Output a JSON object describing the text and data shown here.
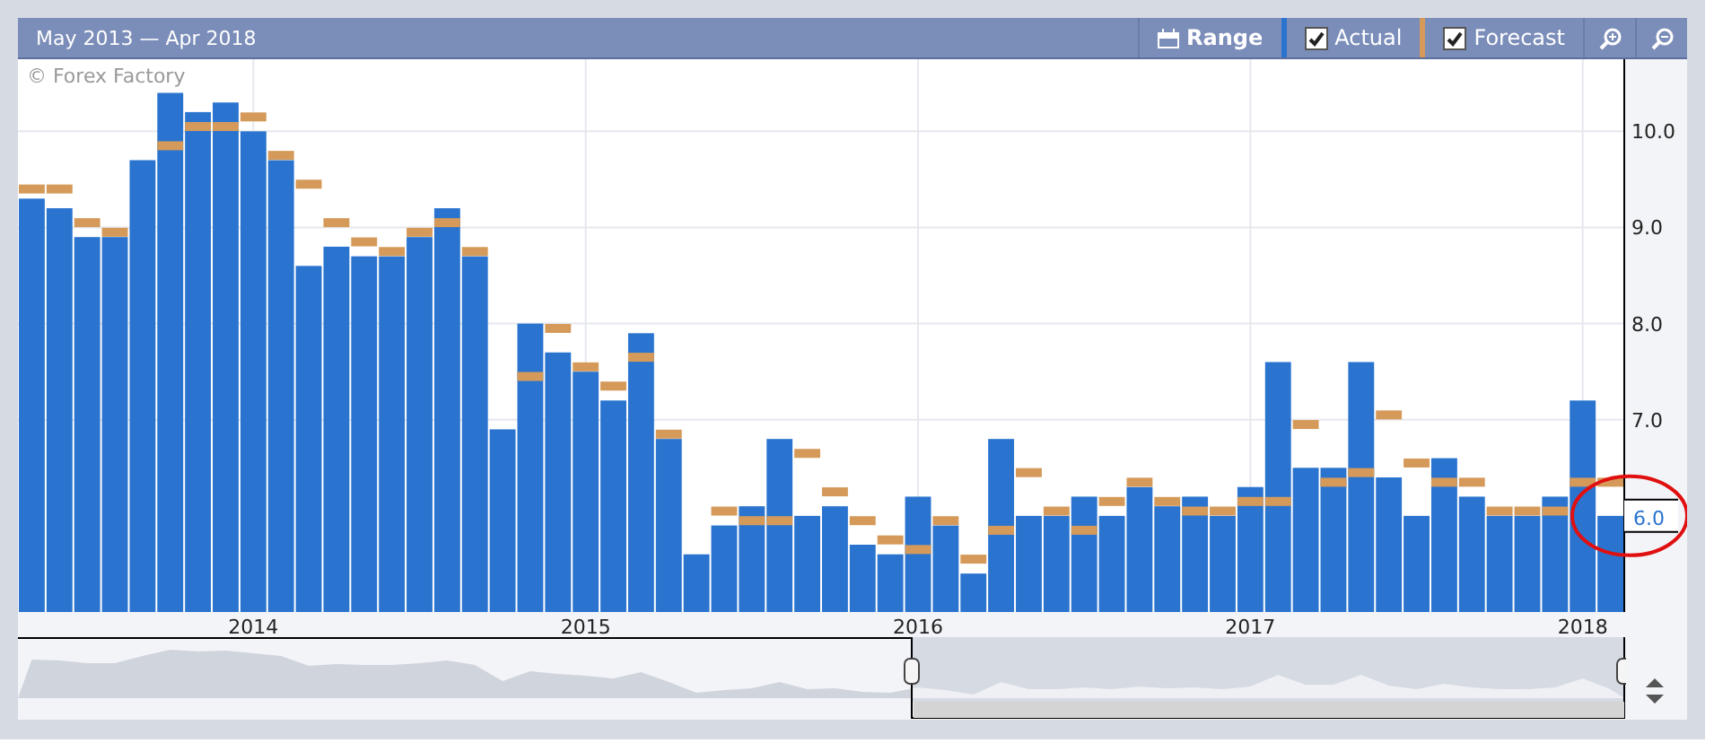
{
  "header": {
    "title": "May 2013 — Apr 2018",
    "buttons": [
      {
        "kind": "range",
        "label": "Range"
      },
      {
        "kind": "toggle",
        "checked": true
      },
      {
        "kind": "toggle",
        "checked": true
      },
      {
        "kind": "zoom-in"
      },
      {
        "kind": "zoom-out"
      }
    ]
  },
  "credit": "© Forex Factory",
  "chart_data": {
    "type": "bar",
    "ylim": [
      5,
      10.75
    ],
    "grid": true,
    "series": [
      {
        "name": "Actual",
        "color": "#2a74d0",
        "values": [
          9.3,
          9.2,
          8.9,
          8.9,
          9.7,
          10.4,
          10.2,
          10.3,
          10.0,
          9.7,
          8.6,
          8.8,
          8.7,
          8.7,
          8.9,
          9.2,
          8.7,
          6.9,
          8.0,
          7.7,
          7.5,
          7.2,
          7.9,
          6.8,
          5.6,
          5.9,
          6.1,
          6.8,
          6.0,
          6.1,
          5.7,
          5.6,
          6.2,
          5.9,
          5.4,
          6.8,
          6.0,
          6.0,
          6.2,
          6.0,
          6.3,
          6.1,
          6.2,
          6.0,
          6.3,
          7.6,
          6.5,
          6.5,
          7.6,
          6.4,
          6.0,
          6.6,
          6.2,
          6.0,
          6.0,
          6.2,
          7.2,
          6.0
        ]
      },
      {
        "name": "Forecast",
        "type": "scatter",
        "color": "#d59a5a",
        "values": [
          9.4,
          9.4,
          9.05,
          8.95,
          null,
          9.85,
          10.05,
          10.05,
          10.15,
          9.75,
          9.45,
          9.05,
          8.85,
          8.75,
          8.95,
          9.05,
          8.75,
          null,
          7.45,
          7.95,
          7.55,
          7.35,
          7.65,
          6.85,
          null,
          6.05,
          5.95,
          5.95,
          6.65,
          6.25,
          5.95,
          5.75,
          5.65,
          5.95,
          5.55,
          5.85,
          6.45,
          6.05,
          5.85,
          6.15,
          6.35,
          6.15,
          6.05,
          6.05,
          6.15,
          6.15,
          6.95,
          6.35,
          6.45,
          7.05,
          6.55,
          6.35,
          6.35,
          6.05,
          6.05,
          6.05,
          6.35,
          6.35
        ]
      }
    ],
    "yticks": [
      {
        "value": 7,
        "label": "7.0"
      },
      {
        "value": 8,
        "label": "8.0"
      },
      {
        "value": 9,
        "label": "9.0"
      },
      {
        "value": 10,
        "label": "10.0"
      }
    ],
    "annotations": [
      {
        "text": "6.0",
        "y": 6.0
      }
    ]
  },
  "year_labels": [
    "2014",
    "2015",
    "2016",
    "2017",
    "2018"
  ]
}
